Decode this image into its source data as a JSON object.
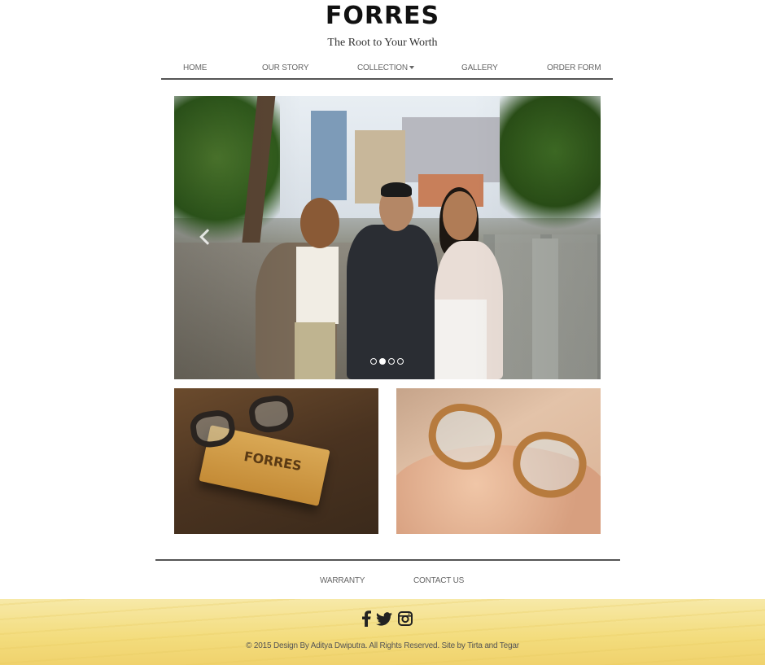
{
  "brand": {
    "logo_text": "FORRES",
    "tagline": "The Root to Your Worth"
  },
  "nav": {
    "items": [
      {
        "label": "HOME"
      },
      {
        "label": "OUR STORY"
      },
      {
        "label": "COLLECTION",
        "has_dropdown": true
      },
      {
        "label": "GALLERY"
      },
      {
        "label": "ORDER FORM"
      }
    ]
  },
  "carousel": {
    "slide_count": 4,
    "active_index": 1
  },
  "products": {
    "box_logo": "FORRES"
  },
  "footer": {
    "links": [
      {
        "label": "WARRANTY"
      },
      {
        "label": "CONTACT US"
      }
    ],
    "social_icons": [
      "facebook-icon",
      "twitter-icon",
      "instagram-icon"
    ],
    "copyright": "© 2015 Design By Aditya Dwiputra. All Rights Reserved. Site by Tirta and Tegar"
  },
  "colors": {
    "nav_rule": "#555555",
    "wood_light": "#f7e9a8",
    "wood_dark": "#f0d26d"
  }
}
